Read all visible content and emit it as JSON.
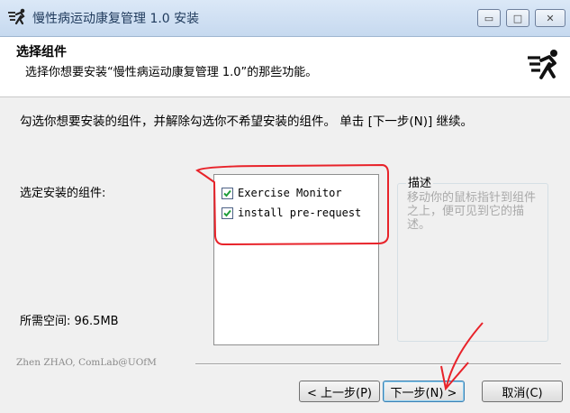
{
  "window": {
    "title": "慢性病运动康复管理 1.0 安装",
    "min_label": "▭",
    "max_label": "□",
    "close_label": "✕"
  },
  "header": {
    "title": "选择组件",
    "subtitle": "选择你想要安装“慢性病运动康复管理 1.0”的那些功能。"
  },
  "instruction": "勾选你想要安装的组件，并解除勾选你不希望安装的组件。 单击 [下一步(N)] 继续。",
  "components": {
    "label": "选定安装的组件:",
    "items": [
      {
        "label": "Exercise Monitor",
        "checked": true
      },
      {
        "label": "install pre-request",
        "checked": true
      }
    ]
  },
  "space": {
    "label": "所需空间: 96.5MB"
  },
  "description": {
    "title": "描述",
    "text": "移动你的鼠标指针到组件之上，便可见到它的描述。"
  },
  "branding": "Zhen ZHAO, ComLab@UOfM",
  "buttons": {
    "back": "< 上一步(P)",
    "next": "下一步(N) >",
    "cancel": "取消(C)"
  },
  "colors": {
    "annotation": "#e8232a",
    "checkmark": "#1f9d3a"
  }
}
